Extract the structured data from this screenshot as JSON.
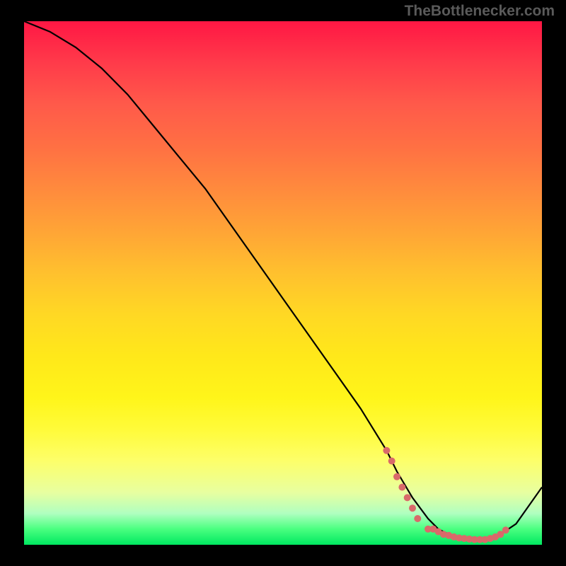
{
  "watermark": "TheBottlenecker.com",
  "chart_data": {
    "type": "line",
    "title": "",
    "xlabel": "",
    "ylabel": "",
    "xlim": [
      0,
      100
    ],
    "ylim": [
      0,
      100
    ],
    "background": "red-to-green vertical gradient (bottleneck severity heatmap)",
    "series": [
      {
        "name": "bottleneck-curve",
        "x": [
          0,
          5,
          10,
          15,
          20,
          25,
          30,
          35,
          40,
          45,
          50,
          55,
          60,
          65,
          70,
          72,
          75,
          78,
          80,
          82,
          85,
          88,
          90,
          92,
          95,
          100
        ],
        "y": [
          100,
          98,
          95,
          91,
          86,
          80,
          74,
          68,
          61,
          54,
          47,
          40,
          33,
          26,
          18,
          14,
          9,
          5,
          3,
          2,
          1,
          1,
          1,
          2,
          4,
          11
        ]
      }
    ],
    "markers": {
      "name": "highlighted-range-dots",
      "color": "#d96a6a",
      "x": [
        70,
        71,
        72,
        73,
        74,
        75,
        76,
        78,
        79,
        80,
        81,
        82,
        83,
        84,
        85,
        86,
        87,
        88,
        89,
        90,
        91,
        92,
        93
      ],
      "y": [
        18,
        16,
        13,
        11,
        9,
        7,
        5,
        3,
        3,
        2.5,
        2,
        1.8,
        1.5,
        1.3,
        1.2,
        1.1,
        1,
        1,
        1,
        1.2,
        1.5,
        2,
        2.8
      ]
    }
  }
}
